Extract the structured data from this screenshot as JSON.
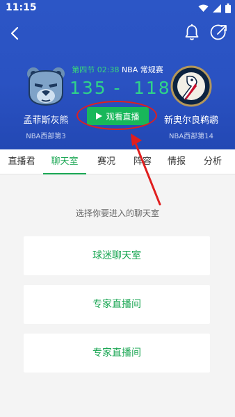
{
  "statusbar": {
    "time": "11:15"
  },
  "match": {
    "period": "第四节 02:38",
    "league": "NBA 常规赛",
    "home": {
      "name": "孟菲斯灰熊",
      "rank": "NBA西部第3",
      "score": "135"
    },
    "away": {
      "name": "新奥尔良鹈鹕",
      "rank": "NBA西部第14",
      "score": "118"
    },
    "dash": "-",
    "watch_label": "观看直播"
  },
  "tabs": [
    {
      "label": "直播君"
    },
    {
      "label": "聊天室"
    },
    {
      "label": "赛况"
    },
    {
      "label": "阵容"
    },
    {
      "label": "情报"
    },
    {
      "label": "分析"
    }
  ],
  "active_tab": "聊天室",
  "chat": {
    "prompt": "选择你要进入的聊天室",
    "rooms": [
      {
        "label": "球迷聊天室"
      },
      {
        "label": "专家直播间"
      },
      {
        "label": "专家直播间"
      }
    ]
  },
  "colors": {
    "hero_blue": "#2a52c2",
    "accent_green": "#1aa653",
    "score_green": "#2fd489",
    "annotation_red": "#e01e1e"
  },
  "icons": [
    "back-icon",
    "bell-icon",
    "share-icon",
    "play-icon",
    "wifi-icon",
    "signal-icon",
    "battery-icon",
    "grizzlies-logo",
    "pelicans-logo"
  ]
}
